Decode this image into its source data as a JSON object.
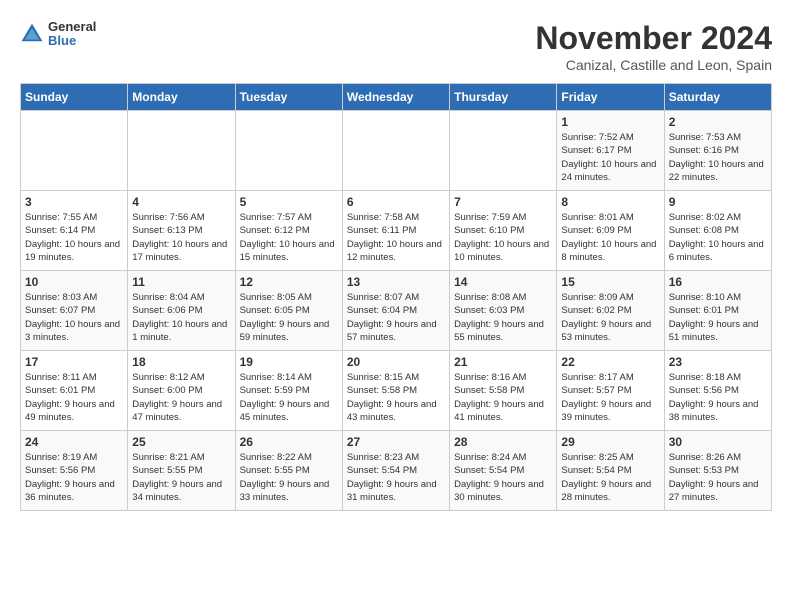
{
  "header": {
    "logo_general": "General",
    "logo_blue": "Blue",
    "month_title": "November 2024",
    "subtitle": "Canizal, Castille and Leon, Spain"
  },
  "days_of_week": [
    "Sunday",
    "Monday",
    "Tuesday",
    "Wednesday",
    "Thursday",
    "Friday",
    "Saturday"
  ],
  "weeks": [
    [
      {
        "day": "",
        "info": ""
      },
      {
        "day": "",
        "info": ""
      },
      {
        "day": "",
        "info": ""
      },
      {
        "day": "",
        "info": ""
      },
      {
        "day": "",
        "info": ""
      },
      {
        "day": "1",
        "info": "Sunrise: 7:52 AM\nSunset: 6:17 PM\nDaylight: 10 hours and 24 minutes."
      },
      {
        "day": "2",
        "info": "Sunrise: 7:53 AM\nSunset: 6:16 PM\nDaylight: 10 hours and 22 minutes."
      }
    ],
    [
      {
        "day": "3",
        "info": "Sunrise: 7:55 AM\nSunset: 6:14 PM\nDaylight: 10 hours and 19 minutes."
      },
      {
        "day": "4",
        "info": "Sunrise: 7:56 AM\nSunset: 6:13 PM\nDaylight: 10 hours and 17 minutes."
      },
      {
        "day": "5",
        "info": "Sunrise: 7:57 AM\nSunset: 6:12 PM\nDaylight: 10 hours and 15 minutes."
      },
      {
        "day": "6",
        "info": "Sunrise: 7:58 AM\nSunset: 6:11 PM\nDaylight: 10 hours and 12 minutes."
      },
      {
        "day": "7",
        "info": "Sunrise: 7:59 AM\nSunset: 6:10 PM\nDaylight: 10 hours and 10 minutes."
      },
      {
        "day": "8",
        "info": "Sunrise: 8:01 AM\nSunset: 6:09 PM\nDaylight: 10 hours and 8 minutes."
      },
      {
        "day": "9",
        "info": "Sunrise: 8:02 AM\nSunset: 6:08 PM\nDaylight: 10 hours and 6 minutes."
      }
    ],
    [
      {
        "day": "10",
        "info": "Sunrise: 8:03 AM\nSunset: 6:07 PM\nDaylight: 10 hours and 3 minutes."
      },
      {
        "day": "11",
        "info": "Sunrise: 8:04 AM\nSunset: 6:06 PM\nDaylight: 10 hours and 1 minute."
      },
      {
        "day": "12",
        "info": "Sunrise: 8:05 AM\nSunset: 6:05 PM\nDaylight: 9 hours and 59 minutes."
      },
      {
        "day": "13",
        "info": "Sunrise: 8:07 AM\nSunset: 6:04 PM\nDaylight: 9 hours and 57 minutes."
      },
      {
        "day": "14",
        "info": "Sunrise: 8:08 AM\nSunset: 6:03 PM\nDaylight: 9 hours and 55 minutes."
      },
      {
        "day": "15",
        "info": "Sunrise: 8:09 AM\nSunset: 6:02 PM\nDaylight: 9 hours and 53 minutes."
      },
      {
        "day": "16",
        "info": "Sunrise: 8:10 AM\nSunset: 6:01 PM\nDaylight: 9 hours and 51 minutes."
      }
    ],
    [
      {
        "day": "17",
        "info": "Sunrise: 8:11 AM\nSunset: 6:01 PM\nDaylight: 9 hours and 49 minutes."
      },
      {
        "day": "18",
        "info": "Sunrise: 8:12 AM\nSunset: 6:00 PM\nDaylight: 9 hours and 47 minutes."
      },
      {
        "day": "19",
        "info": "Sunrise: 8:14 AM\nSunset: 5:59 PM\nDaylight: 9 hours and 45 minutes."
      },
      {
        "day": "20",
        "info": "Sunrise: 8:15 AM\nSunset: 5:58 PM\nDaylight: 9 hours and 43 minutes."
      },
      {
        "day": "21",
        "info": "Sunrise: 8:16 AM\nSunset: 5:58 PM\nDaylight: 9 hours and 41 minutes."
      },
      {
        "day": "22",
        "info": "Sunrise: 8:17 AM\nSunset: 5:57 PM\nDaylight: 9 hours and 39 minutes."
      },
      {
        "day": "23",
        "info": "Sunrise: 8:18 AM\nSunset: 5:56 PM\nDaylight: 9 hours and 38 minutes."
      }
    ],
    [
      {
        "day": "24",
        "info": "Sunrise: 8:19 AM\nSunset: 5:56 PM\nDaylight: 9 hours and 36 minutes."
      },
      {
        "day": "25",
        "info": "Sunrise: 8:21 AM\nSunset: 5:55 PM\nDaylight: 9 hours and 34 minutes."
      },
      {
        "day": "26",
        "info": "Sunrise: 8:22 AM\nSunset: 5:55 PM\nDaylight: 9 hours and 33 minutes."
      },
      {
        "day": "27",
        "info": "Sunrise: 8:23 AM\nSunset: 5:54 PM\nDaylight: 9 hours and 31 minutes."
      },
      {
        "day": "28",
        "info": "Sunrise: 8:24 AM\nSunset: 5:54 PM\nDaylight: 9 hours and 30 minutes."
      },
      {
        "day": "29",
        "info": "Sunrise: 8:25 AM\nSunset: 5:54 PM\nDaylight: 9 hours and 28 minutes."
      },
      {
        "day": "30",
        "info": "Sunrise: 8:26 AM\nSunset: 5:53 PM\nDaylight: 9 hours and 27 minutes."
      }
    ]
  ]
}
